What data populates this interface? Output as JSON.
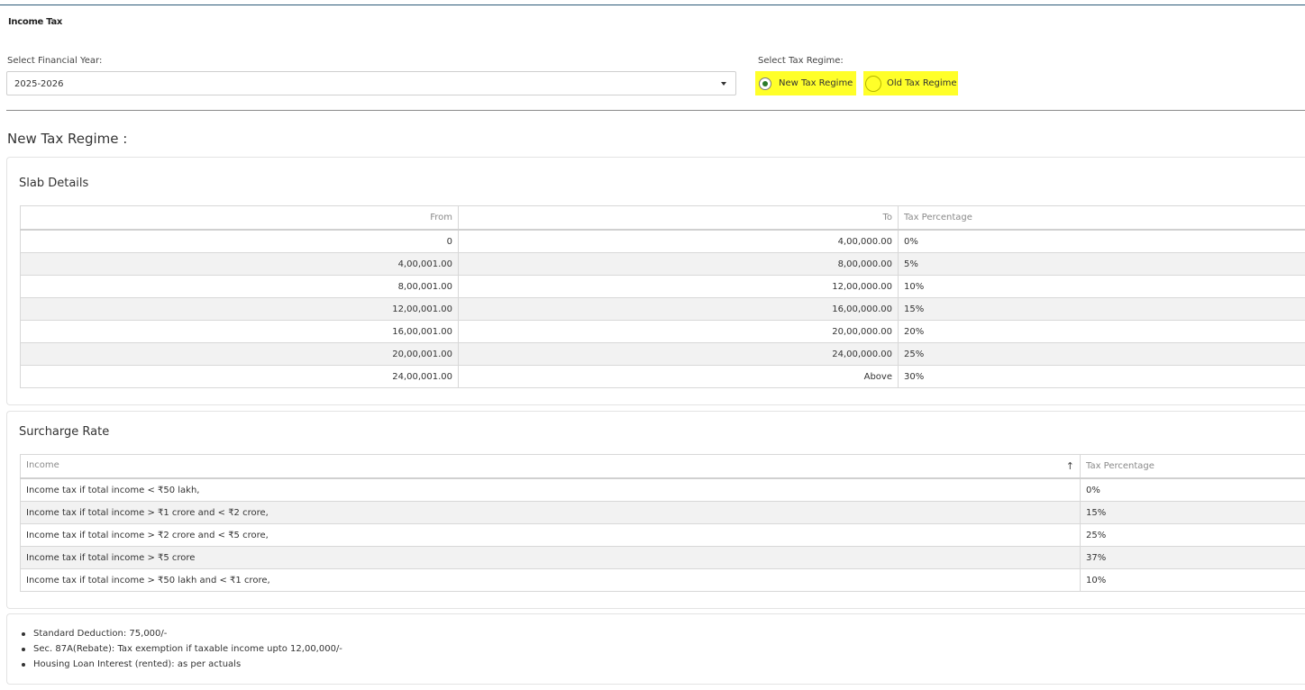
{
  "page": {
    "title": "Income Tax"
  },
  "financial_year": {
    "label": "Select Financial Year:",
    "value": "2025-2026"
  },
  "tax_regime": {
    "label": "Select Tax Regime:",
    "options": [
      {
        "label": "New Tax Regime",
        "selected": true
      },
      {
        "label": "Old Tax Regime",
        "selected": false
      }
    ],
    "highlight_color": "#ffff29"
  },
  "section_title": "New Tax Regime :",
  "slab_details": {
    "title": "Slab Details",
    "columns": [
      "From",
      "To",
      "Tax Percentage"
    ],
    "rows": [
      [
        "0",
        "4,00,000.00",
        "0%"
      ],
      [
        "4,00,001.00",
        "8,00,000.00",
        "5%"
      ],
      [
        "8,00,001.00",
        "12,00,000.00",
        "10%"
      ],
      [
        "12,00,001.00",
        "16,00,000.00",
        "15%"
      ],
      [
        "16,00,001.00",
        "20,00,000.00",
        "20%"
      ],
      [
        "20,00,001.00",
        "24,00,000.00",
        "25%"
      ],
      [
        "24,00,001.00",
        "Above",
        "30%"
      ]
    ]
  },
  "surcharge_rate": {
    "title": "Surcharge Rate",
    "columns": [
      "Income",
      "Tax Percentage"
    ],
    "sort_icon": "↑",
    "rows": [
      [
        "Income tax if total income < ₹50 lakh,",
        "0%"
      ],
      [
        "Income tax if total income > ₹1 crore and < ₹2 crore,",
        "15%"
      ],
      [
        "Income tax if total income > ₹2 crore and < ₹5 crore,",
        "25%"
      ],
      [
        "Income tax if total income > ₹5 crore",
        "37%"
      ],
      [
        "Income tax if total income > ₹50 lakh and < ₹1 crore,",
        "10%"
      ]
    ]
  },
  "notes": [
    "Standard Deduction: 75,000/-",
    "Sec. 87A(Rebate): Tax exemption if taxable income upto 12,00,000/-",
    "Housing Loan Interest (rented): as per actuals"
  ]
}
